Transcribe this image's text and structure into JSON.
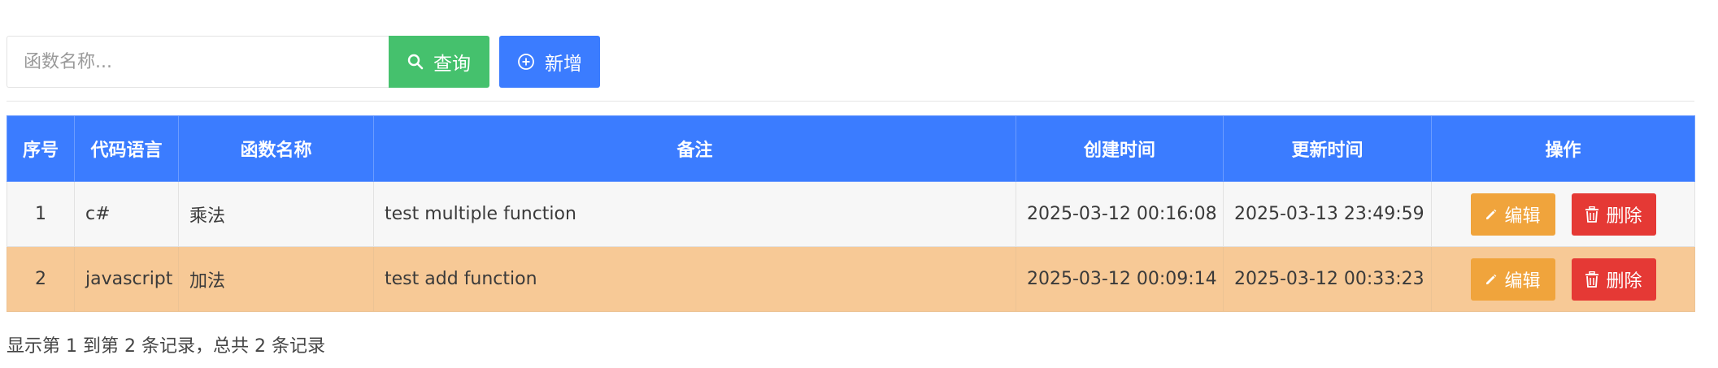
{
  "toolbar": {
    "search_placeholder": "函数名称...",
    "query_label": "查询",
    "add_label": "新增",
    "query_color": "#45c16d",
    "add_color": "#3b7cff"
  },
  "table": {
    "headers": [
      "序号",
      "代码语言",
      "函数名称",
      "备注",
      "创建时间",
      "更新时间",
      "操作"
    ],
    "rows": [
      {
        "index": "1",
        "language": "c#",
        "name": "乘法",
        "remark": "test multiple function",
        "created": "2025-03-12 00:16:08",
        "updated": "2025-03-13 23:49:59",
        "edit": "编辑",
        "delete": "删除"
      },
      {
        "index": "2",
        "language": "javascript",
        "name": "加法",
        "remark": "test add function",
        "created": "2025-03-12 00:09:14",
        "updated": "2025-03-12 00:33:23",
        "edit": "编辑",
        "delete": "删除"
      }
    ]
  },
  "footer": {
    "summary": "显示第 1 到第 2 条记录，总共 2 条记录"
  },
  "icons": {
    "query": "search-icon",
    "add": "plus-circle-icon",
    "edit": "pencil-icon",
    "delete": "trash-icon"
  }
}
